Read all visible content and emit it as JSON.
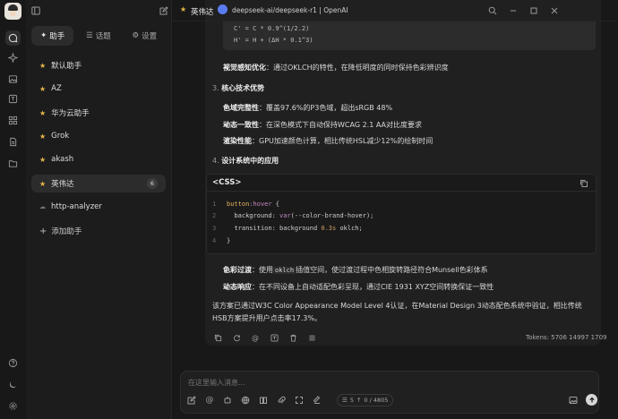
{
  "rail": {
    "icons": [
      "chat-icon",
      "sparkle-icon",
      "image-icon",
      "translate-icon",
      "grid-icon",
      "document-icon",
      "folder-icon"
    ],
    "bottom_icons": [
      "help-icon",
      "moon-icon",
      "settings-icon"
    ]
  },
  "sidebar": {
    "tabs": [
      {
        "label": "助手",
        "icon": "✦"
      },
      {
        "label": "话题",
        "icon": "☰"
      },
      {
        "label": "设置",
        "icon": "⚙"
      }
    ],
    "assistants": [
      {
        "label": "默认助手"
      },
      {
        "label": "AZ"
      },
      {
        "label": "华为云助手"
      },
      {
        "label": "Grok"
      },
      {
        "label": "akash"
      },
      {
        "label": "英伟达",
        "badge": "6"
      },
      {
        "label": "http-analyzer"
      }
    ],
    "add_label": "添加助手"
  },
  "header": {
    "assistant_name": "英伟达",
    "model": "deepseek-ai/deepseek-r1 | OpenAI"
  },
  "message": {
    "code_lines": [
      "C' = C * 0.9^(1/2.2)",
      "H' = H + (ΔH * 0.1^3)"
    ],
    "perception_title": "视觉感知优化",
    "perception_text": "：通过OKLCH的特性，在降低明度的同时保持色彩辨识度",
    "sec3_num": "3.",
    "sec3_title": "核心技术优势",
    "adv": [
      {
        "title": "色域完整性",
        "text": "：覆盖97.6%的P3色域，超出sRGB 48%"
      },
      {
        "title": "动态一致性",
        "text": "：在深色模式下自动保持WCAG 2.1 AA对比度要求"
      },
      {
        "title": "渲染性能",
        "text": "：GPU加速颜色计算，相比传统HSL减少12%的绘制时间"
      }
    ],
    "sec4_num": "4.",
    "sec4_title": "设计系统中的应用",
    "css_block": {
      "lang": "<CSS>",
      "lines": [
        {
          "n": "1",
          "sel": "button",
          "pseudo": ":hover",
          "brace": " {"
        },
        {
          "n": "2",
          "prop": "background: ",
          "fn": "var",
          "arg": "(--color-brand-hover);"
        },
        {
          "n": "3",
          "prop": "transition: background ",
          "num": "0.3s",
          "rest": " oklch;"
        },
        {
          "n": "4",
          "close": "}"
        }
      ]
    },
    "transition_title": "色彩过渡",
    "transition_pre": "：使用",
    "transition_code": "oklch",
    "transition_post": "插值空间，使过渡过程中色相旋转路径符合Munsell色彩体系",
    "responsive_title": "动态响应",
    "responsive_text": "：在不同设备上自动适配色彩呈现，通过CIE 1931 XYZ空间转换保证一致性",
    "summary_1": "该方案已通过W3C Color Appearance Model Level 4认证，在Material Design 3动态配色系统中验证，相比传统",
    "summary_2": "HSB方案提升用户点击率17.3%。",
    "tokens": "Tokens: 5706 14997 1709"
  },
  "input": {
    "placeholder": "在这里输入消息...",
    "context": "5",
    "counter": "0 / 4805"
  }
}
